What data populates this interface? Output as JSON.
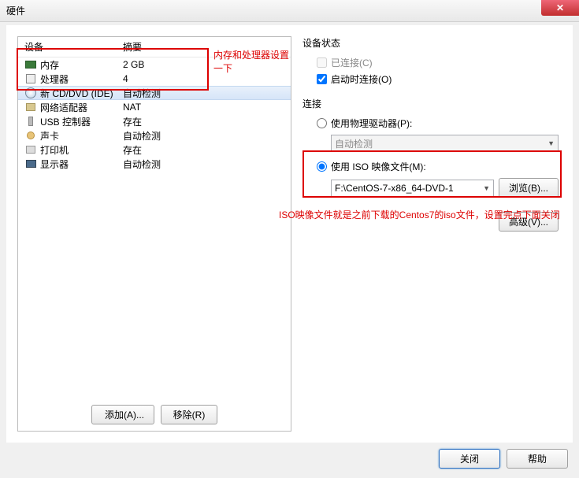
{
  "window": {
    "title": "硬件"
  },
  "list": {
    "header_device": "设备",
    "header_summary": "摘要",
    "rows": [
      {
        "name": "内存",
        "summary": "2 GB",
        "icon": "memory"
      },
      {
        "name": "处理器",
        "summary": "4",
        "icon": "cpu"
      },
      {
        "name": "新 CD/DVD (IDE)",
        "summary": "自动检测",
        "icon": "cd",
        "selected": true
      },
      {
        "name": "网络适配器",
        "summary": "NAT",
        "icon": "network"
      },
      {
        "name": "USB 控制器",
        "summary": "存在",
        "icon": "usb"
      },
      {
        "name": "声卡",
        "summary": "自动检测",
        "icon": "sound"
      },
      {
        "name": "打印机",
        "summary": "存在",
        "icon": "printer"
      },
      {
        "name": "显示器",
        "summary": "自动检测",
        "icon": "monitor"
      }
    ]
  },
  "annotations": {
    "a1": "内存和处理器设置一下",
    "a2": "ISO映像文件就是之前下载的Centos7的iso文件，设置完点下面关闭"
  },
  "left_buttons": {
    "add": "添加(A)...",
    "remove": "移除(R)"
  },
  "status": {
    "title": "设备状态",
    "connected": "已连接(C)",
    "connect_on_power": "启动时连接(O)"
  },
  "connection": {
    "title": "连接",
    "use_physical": "使用物理驱动器(P):",
    "physical_value": "自动检测",
    "use_iso": "使用 ISO 映像文件(M):",
    "iso_value": "F:\\CentOS-7-x86_64-DVD-1",
    "browse": "浏览(B)..."
  },
  "advanced": "高级(V)...",
  "footer": {
    "close": "关闭",
    "help": "帮助"
  }
}
